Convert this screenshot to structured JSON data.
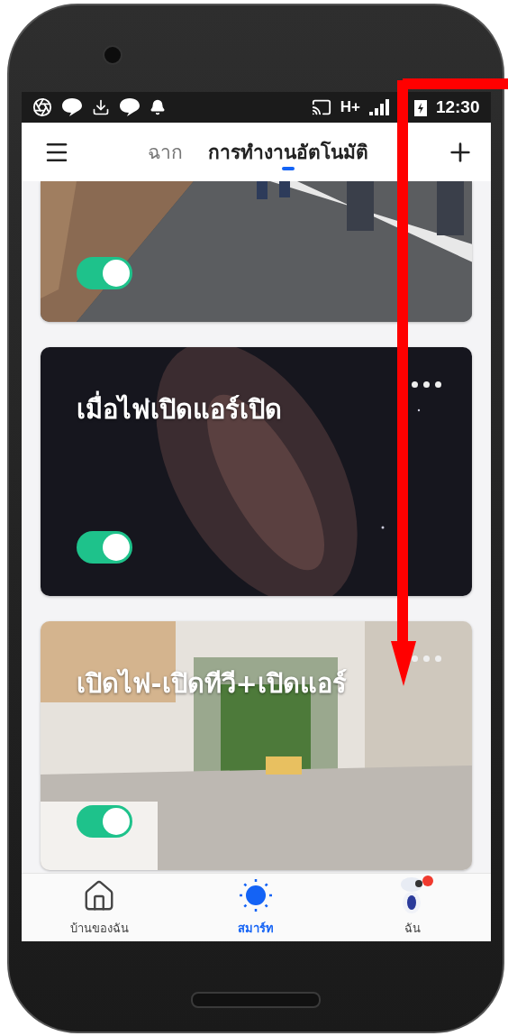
{
  "status_bar": {
    "network": "H+",
    "time": "12:30"
  },
  "app_bar": {
    "tabs": [
      {
        "label": "ฉาก",
        "selected": false
      },
      {
        "label": "การทำงานอัตโนมัติ",
        "selected": true
      }
    ]
  },
  "automations": [
    {
      "kind": "walkway",
      "on": true
    },
    {
      "kind": "stars",
      "title": "เมื่อไฟเปิดแอร์เปิด",
      "on": true
    },
    {
      "kind": "kitchen",
      "title": "เปิดไฟ-เปิดทีวี+เปิดแอร์",
      "on": true
    }
  ],
  "bottom_nav": [
    {
      "kind": "home",
      "label": "บ้านของฉัน",
      "selected": false
    },
    {
      "kind": "smart",
      "label": "สมาร์ท",
      "selected": true
    },
    {
      "kind": "me",
      "label": "ฉัน",
      "selected": false,
      "badge": true
    }
  ]
}
